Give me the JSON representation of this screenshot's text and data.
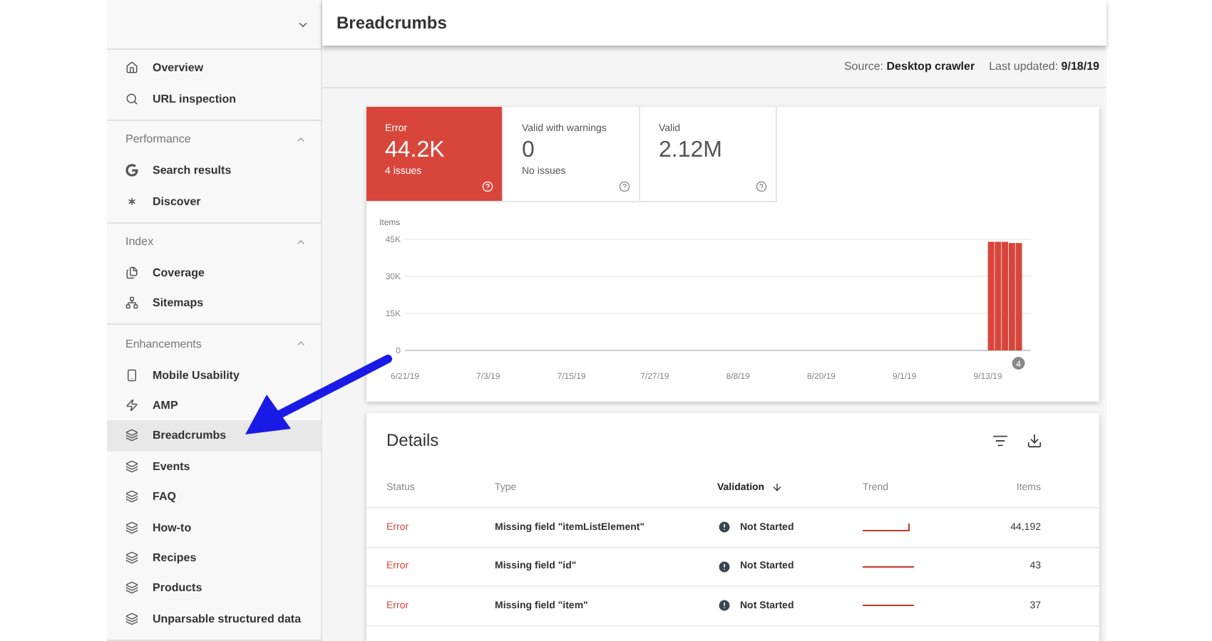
{
  "header": {
    "title": "Breadcrumbs"
  },
  "sidebar": {
    "sections": [
      {
        "items": [
          {
            "label": "Overview",
            "selected": false
          },
          {
            "label": "URL inspection",
            "selected": false
          }
        ]
      },
      {
        "title": "Performance",
        "expanded": true,
        "items": [
          {
            "label": "Search results",
            "selected": false
          },
          {
            "label": "Discover",
            "selected": false
          }
        ]
      },
      {
        "title": "Index",
        "expanded": true,
        "items": [
          {
            "label": "Coverage",
            "selected": false
          },
          {
            "label": "Sitemaps",
            "selected": false
          }
        ]
      },
      {
        "title": "Enhancements",
        "expanded": true,
        "items": [
          {
            "label": "Mobile Usability",
            "selected": false
          },
          {
            "label": "AMP",
            "selected": false
          },
          {
            "label": "Breadcrumbs",
            "selected": true
          },
          {
            "label": "Events",
            "selected": false
          },
          {
            "label": "FAQ",
            "selected": false
          },
          {
            "label": "How-to",
            "selected": false
          },
          {
            "label": "Recipes",
            "selected": false
          },
          {
            "label": "Products",
            "selected": false
          },
          {
            "label": "Unparsable structured data",
            "selected": false
          }
        ]
      }
    ]
  },
  "source_bar": {
    "source_label": "Source:",
    "source_value": "Desktop crawler",
    "updated_label": "Last updated:",
    "updated_value": "9/18/19"
  },
  "tiles": [
    {
      "label": "Error",
      "value": "44.2K",
      "note": "4 issues",
      "selected": true
    },
    {
      "label": "Valid with warnings",
      "value": "0",
      "note": "No issues",
      "selected": false
    },
    {
      "label": "Valid",
      "value": "2.12M",
      "selected": false
    }
  ],
  "chart_data": {
    "type": "bar",
    "ylabel": "Items",
    "categories": [
      "6/21/19",
      null,
      null,
      null,
      null,
      null,
      null,
      null,
      null,
      null,
      null,
      null,
      "7/3/19",
      null,
      null,
      null,
      null,
      null,
      null,
      null,
      null,
      null,
      null,
      null,
      "7/15/19",
      null,
      null,
      null,
      null,
      null,
      null,
      null,
      null,
      null,
      null,
      null,
      "7/27/19",
      null,
      null,
      null,
      null,
      null,
      null,
      null,
      null,
      null,
      null,
      null,
      "8/8/19",
      null,
      null,
      null,
      null,
      null,
      null,
      null,
      null,
      null,
      null,
      null,
      "8/20/19",
      null,
      null,
      null,
      null,
      null,
      null,
      null,
      null,
      null,
      null,
      null,
      "9/1/19",
      null,
      null,
      null,
      null,
      null,
      null,
      null,
      null,
      null,
      null,
      null,
      "9/13/19",
      null,
      null,
      null,
      null,
      null,
      null
    ],
    "values": [
      null,
      null,
      null,
      null,
      null,
      null,
      null,
      null,
      null,
      null,
      null,
      null,
      null,
      null,
      null,
      null,
      null,
      null,
      null,
      null,
      null,
      null,
      null,
      null,
      null,
      null,
      null,
      null,
      null,
      null,
      null,
      null,
      null,
      null,
      null,
      null,
      null,
      null,
      null,
      null,
      null,
      null,
      null,
      null,
      null,
      null,
      null,
      null,
      null,
      null,
      null,
      null,
      null,
      null,
      null,
      null,
      null,
      null,
      null,
      null,
      null,
      null,
      null,
      null,
      null,
      null,
      null,
      null,
      null,
      null,
      null,
      null,
      null,
      null,
      null,
      null,
      null,
      null,
      null,
      null,
      null,
      null,
      null,
      null,
      44000,
      44000,
      44000,
      43500,
      43500,
      null,
      null
    ],
    "ylim": [
      0,
      45000
    ],
    "yticks": [
      {
        "value": 0,
        "label": "0"
      },
      {
        "value": 15000,
        "label": "15K"
      },
      {
        "value": 30000,
        "label": "30K"
      },
      {
        "value": 45000,
        "label": "45K"
      }
    ],
    "annotations": [
      "4"
    ]
  },
  "details": {
    "title": "Details",
    "columns": [
      "Status",
      "Type",
      "Validation",
      "Trend",
      "Items"
    ],
    "rows": [
      {
        "status": "Error",
        "type": "Missing field \"itemListElement\"",
        "validation": "Not Started",
        "kind": "step",
        "items": "44,192"
      },
      {
        "status": "Error",
        "type": "Missing field \"id\"",
        "validation": "Not Started",
        "kind": "flat",
        "items": "43"
      },
      {
        "status": "Error",
        "type": "Missing field \"item\"",
        "validation": "Not Started",
        "kind": "flat",
        "items": "37"
      }
    ]
  }
}
